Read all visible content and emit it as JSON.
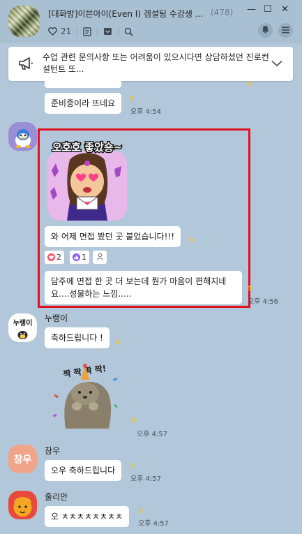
{
  "header": {
    "title": "[대화방]이븐아이(Even I) 겜설팅 수강생 ...",
    "member_count": "(478)",
    "likes": "21",
    "minimize_glyph": "—",
    "maximize_glyph": "☐",
    "close_glyph": "✕"
  },
  "notice": {
    "text": "수업 관련 문의사항 또는 어려움이 있으시다면 상담하셨던 진로컨설턴트 또..."
  },
  "messages": {
    "m1": {
      "text": "준비중이라 뜨네요",
      "unread": "3",
      "time": "오후 4:54"
    },
    "m2": {
      "sticker_text": "오호호 좋았숑~",
      "text": "와 어제 면접 봤던 곳 붙었습니다!!!",
      "unread": "3",
      "react_heart": "2",
      "react_like": "1"
    },
    "m3": {
      "text": "담주에 면접 한 곳 더 보는데 뭔가 마음이 편해지네요....성불하는 느낌.....",
      "unread": "3",
      "time": "오후 4:56"
    },
    "m4": {
      "sender": "누랭이",
      "avatar_label": "누랭이",
      "text": "축하드립니다 !",
      "unread": "3",
      "sticker_text": "짝 짝 짝 짝!",
      "sticker_unread": "3",
      "time": "오후 4:57"
    },
    "m5": {
      "sender": "창우",
      "avatar_label": "창우",
      "text": "오우 축하드립니다",
      "unread": "3",
      "time": "오후 4:57"
    },
    "m6": {
      "sender": "줄리안",
      "text": "오 ㅊㅊㅊㅊㅊㅊㅊㅊ",
      "unread": "3",
      "time": "오후 4:57"
    }
  },
  "colors": {
    "chat_background": "#b2c7d9",
    "header_background": "#a9bfd2",
    "highlight_border": "#e0101f",
    "unread_yellow": "#f0c419"
  },
  "icons": [
    "heart-icon",
    "notes-icon",
    "inbox-icon",
    "search-icon",
    "bell-icon",
    "menu-icon",
    "megaphone-icon",
    "chevron-down-icon"
  ]
}
